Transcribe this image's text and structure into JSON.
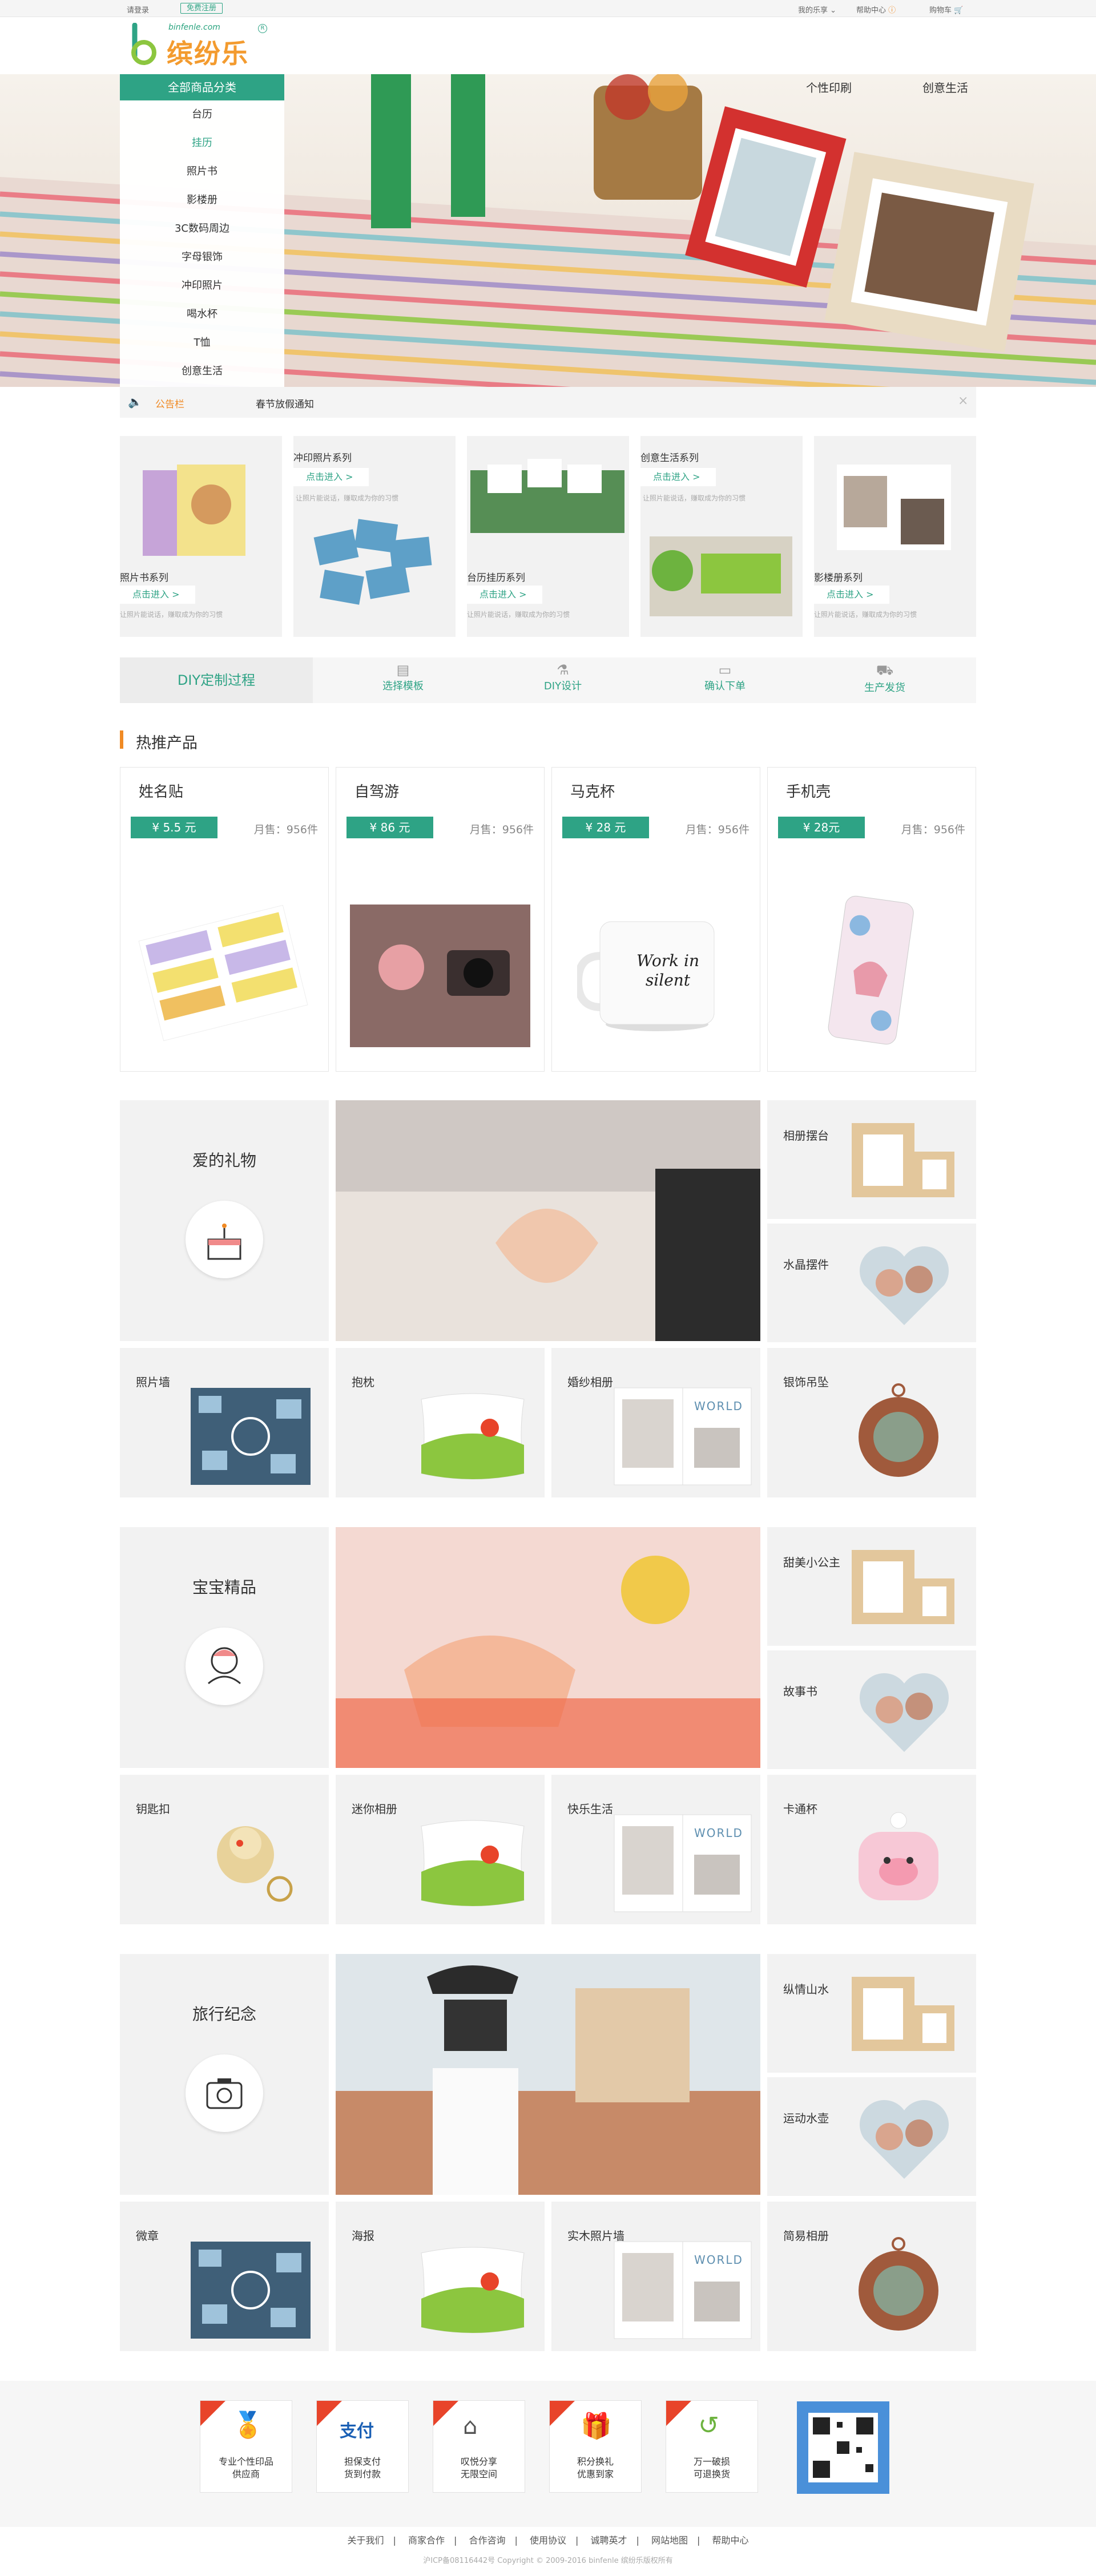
{
  "topbar": {
    "login": "请登录",
    "register": "免费注册",
    "my": "我的乐享",
    "help": "帮助中心",
    "cart": "购物车"
  },
  "logo": {
    "url": "binfenle.com",
    "name": "缤纷乐"
  },
  "nav": {
    "items": [
      "个性印刷",
      "创意生活"
    ]
  },
  "menu": {
    "title": "全部商品分类",
    "items": [
      "台历",
      "挂历",
      "照片书",
      "影楼册",
      "3C数码周边",
      "字母银饰",
      "冲印照片",
      "喝水杯",
      "T恤",
      "创意生活"
    ]
  },
  "notice": {
    "label": "公告栏",
    "text": "春节放假通知"
  },
  "series": [
    {
      "name": "照片书系列",
      "btn": "点击进入 >",
      "desc": "让照片能说话，赚取成为你的习惯"
    },
    {
      "name": "冲印照片系列",
      "btn": "点击进入 >",
      "desc": "让照片能说话，赚取成为你的习惯"
    },
    {
      "name": "台历挂历系列",
      "btn": "点击进入 >",
      "desc": "让照片能说话，赚取成为你的习惯"
    },
    {
      "name": "创意生活系列",
      "btn": "点击进入 >",
      "desc": "让照片能说话，赚取成为你的习惯"
    },
    {
      "name": "影楼册系列",
      "btn": "点击进入 >",
      "desc": "让照片能说话，赚取成为你的习惯"
    }
  ],
  "diy": {
    "title": "DIY定制过程",
    "steps": [
      "选择模板",
      "DIY设计",
      "确认下单",
      "生产发货"
    ]
  },
  "hot": {
    "title": "热推产品",
    "items": [
      {
        "name": "姓名贴",
        "price": "¥ 5.5 元",
        "sales": "月售：956件"
      },
      {
        "name": "自驾游",
        "price": "¥ 86 元",
        "sales": "月售：956件"
      },
      {
        "name": "马克杯",
        "price": "¥ 28 元",
        "sales": "月售：956件"
      },
      {
        "name": "手机壳",
        "price": "¥ 28元",
        "sales": "月售：956件"
      }
    ],
    "mug_text": "Work in silent"
  },
  "sections": [
    {
      "title": "爱的礼物",
      "right": [
        "相册摆台",
        "水晶摆件"
      ],
      "bottom": [
        "照片墙",
        "抱枕",
        "婚纱相册",
        "银饰吊坠"
      ]
    },
    {
      "title": "宝宝精品",
      "right": [
        "甜美小公主",
        "故事书"
      ],
      "bottom": [
        "钥匙扣",
        "迷你相册",
        "快乐生活",
        "卡通杯"
      ]
    },
    {
      "title": "旅行纪念",
      "right": [
        "纵情山水",
        "运动水壶"
      ],
      "bottom": [
        "微章",
        "海报",
        "实木照片墙",
        "简易相册"
      ]
    }
  ],
  "album_text": "WORLD",
  "footer": {
    "badges": [
      "专业个性印品\n供应商",
      "担保支付\n货到付款",
      "叹悦分享\n无限空间",
      "积分换礼\n优惠到家",
      "万一破损\n可退换货"
    ],
    "links": [
      "关于我们",
      "商家合作",
      "合作咨询",
      "使用协议",
      "诚聘英才",
      "网站地图",
      "帮助中心"
    ],
    "copyright": "沪ICP备08116442号 Copyright © 2009-2016 binfenle 缤纷乐版权所有"
  }
}
